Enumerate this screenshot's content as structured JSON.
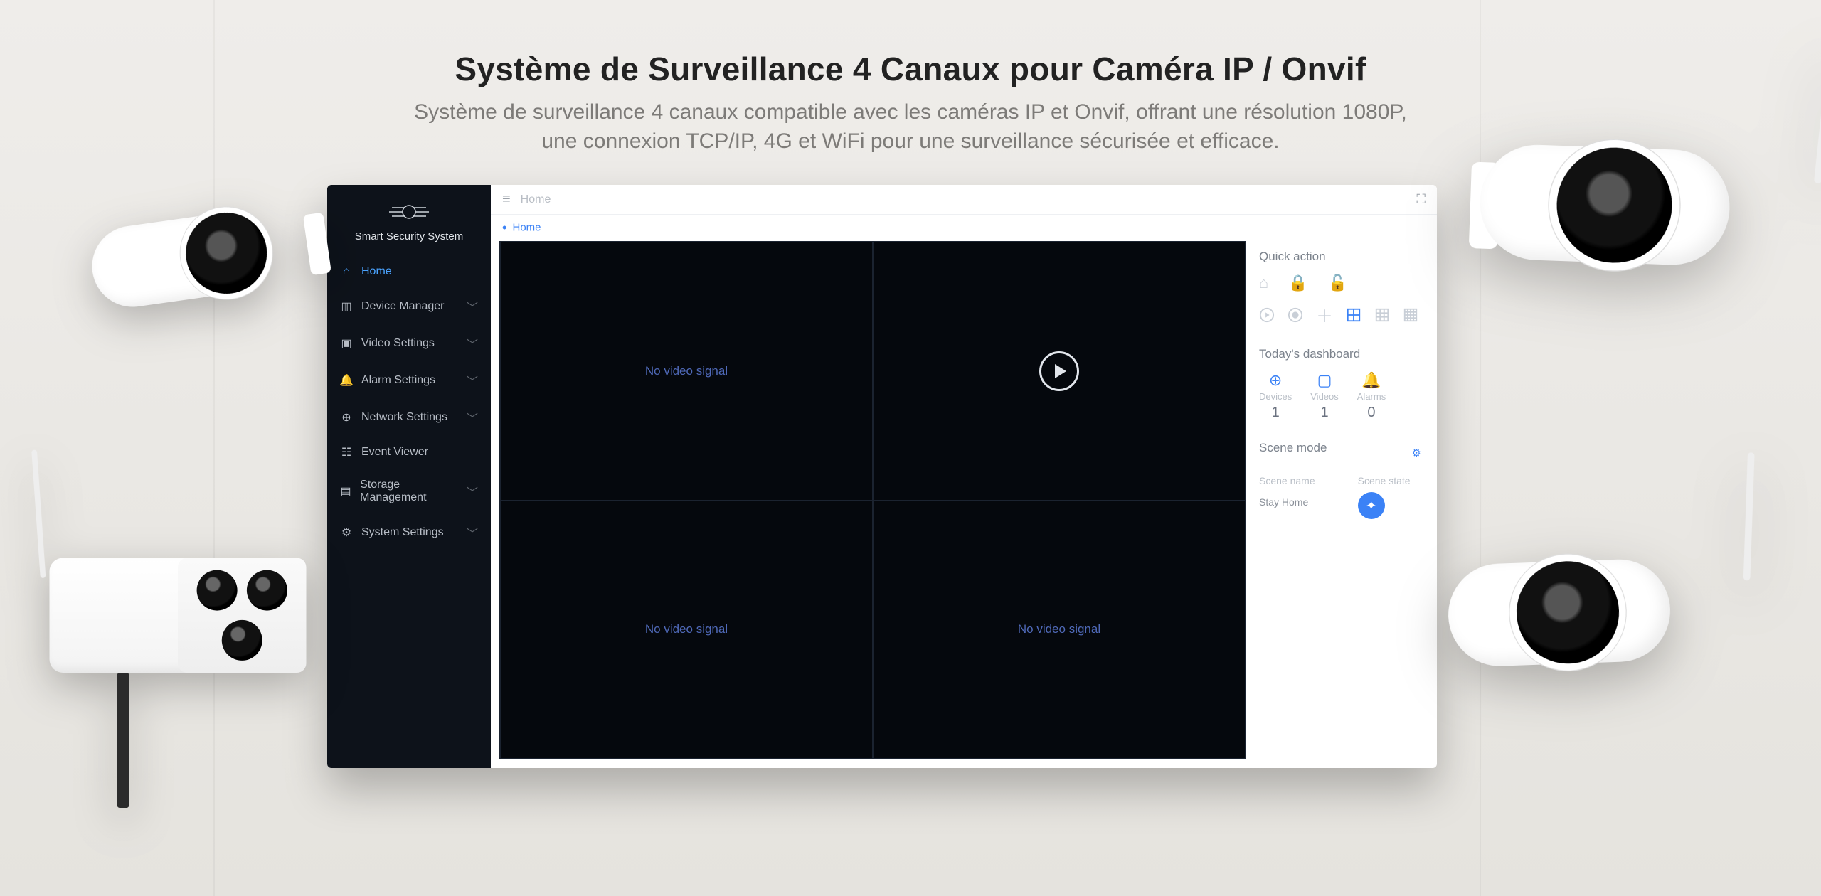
{
  "hero": {
    "title": "Système de Surveillance 4 Canaux pour Caméra IP / Onvif",
    "sub1": "Système de surveillance 4 canaux compatible avec les caméras IP et Onvif, offrant une résolution 1080P,",
    "sub2": "une connexion TCP/IP, 4G et WiFi pour une surveillance sécurisée et efficace."
  },
  "brand_name": "Smart Security System",
  "topbar": {
    "title": "Home"
  },
  "breadcrumb": {
    "home": "Home"
  },
  "sidebar": {
    "items": [
      {
        "label": "Home",
        "active": true
      },
      {
        "label": "Device Manager",
        "active": false
      },
      {
        "label": "Video Settings",
        "active": false
      },
      {
        "label": "Alarm Settings",
        "active": false
      },
      {
        "label": "Network Settings",
        "active": false
      },
      {
        "label": "Event Viewer",
        "active": false
      },
      {
        "label": "Storage Management",
        "active": false
      },
      {
        "label": "System Settings",
        "active": false
      }
    ]
  },
  "grid": {
    "cells": [
      {
        "text": "No video signal"
      },
      {
        "text": ""
      },
      {
        "text": "No video signal"
      },
      {
        "text": "No video signal"
      }
    ]
  },
  "quick_action": {
    "title": "Quick action"
  },
  "dashboard": {
    "title": "Today's dashboard",
    "cols": [
      {
        "label": "Devices",
        "value": "1"
      },
      {
        "label": "Videos",
        "value": "1"
      },
      {
        "label": "Alarms",
        "value": "0"
      }
    ]
  },
  "scene": {
    "title": "Scene mode",
    "name_header": "Scene name",
    "state_header": "Scene state",
    "row_name": "Stay Home"
  }
}
